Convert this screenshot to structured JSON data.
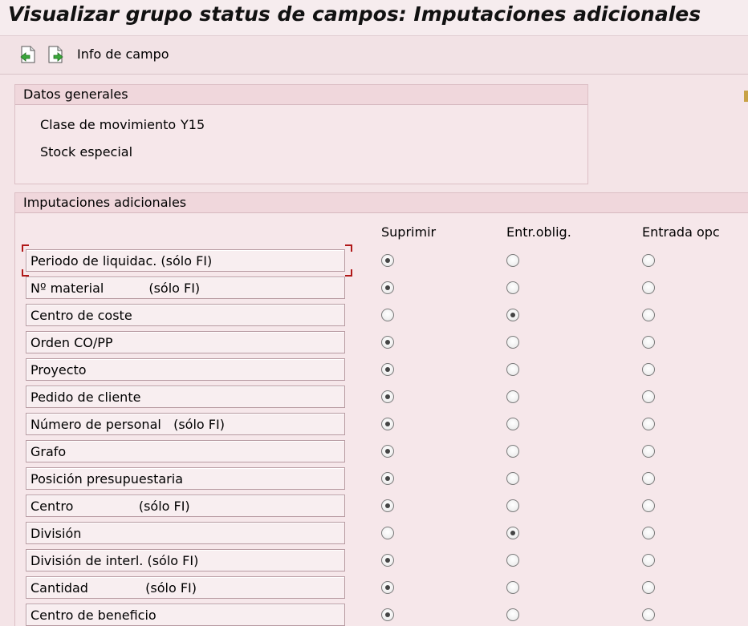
{
  "window": {
    "title": "Visualizar grupo status de campos: Imputaciones adicionales"
  },
  "toolbar": {
    "prev_icon": "previous-page-icon",
    "next_icon": "next-page-icon",
    "info_label": "Info de campo"
  },
  "general": {
    "title": "Datos generales",
    "movement_label": "Clase de movimiento",
    "movement_value": "Y15",
    "stock_label": "Stock especial"
  },
  "imputaciones": {
    "title": "Imputaciones adicionales",
    "columns": [
      "Suprimir",
      "Entr.oblig.",
      "Entrada opc"
    ],
    "rows": [
      {
        "label": "Periodo de liquidac. (sólo FI)",
        "selected": "Suprimir"
      },
      {
        "label": "Nº material           (sólo FI)",
        "selected": "Suprimir"
      },
      {
        "label": "Centro de coste",
        "selected": "Entr.oblig."
      },
      {
        "label": "Orden CO/PP",
        "selected": "Suprimir"
      },
      {
        "label": "Proyecto",
        "selected": "Suprimir"
      },
      {
        "label": "Pedido de cliente",
        "selected": "Suprimir"
      },
      {
        "label": "Número de personal   (sólo FI)",
        "selected": "Suprimir"
      },
      {
        "label": "Grafo",
        "selected": "Suprimir"
      },
      {
        "label": "Posición presupuestaria",
        "selected": "Suprimir"
      },
      {
        "label": "Centro                (sólo FI)",
        "selected": "Suprimir"
      },
      {
        "label": "División",
        "selected": "Entr.oblig."
      },
      {
        "label": "División de interl. (sólo FI)",
        "selected": "Suprimir"
      },
      {
        "label": "Cantidad              (sólo FI)",
        "selected": "Suprimir"
      },
      {
        "label": "Centro de beneficio",
        "selected": "Suprimir"
      }
    ]
  },
  "colors": {
    "background": "#f4e4e7",
    "header": "#f0d7dc",
    "focus": "#b01818"
  }
}
